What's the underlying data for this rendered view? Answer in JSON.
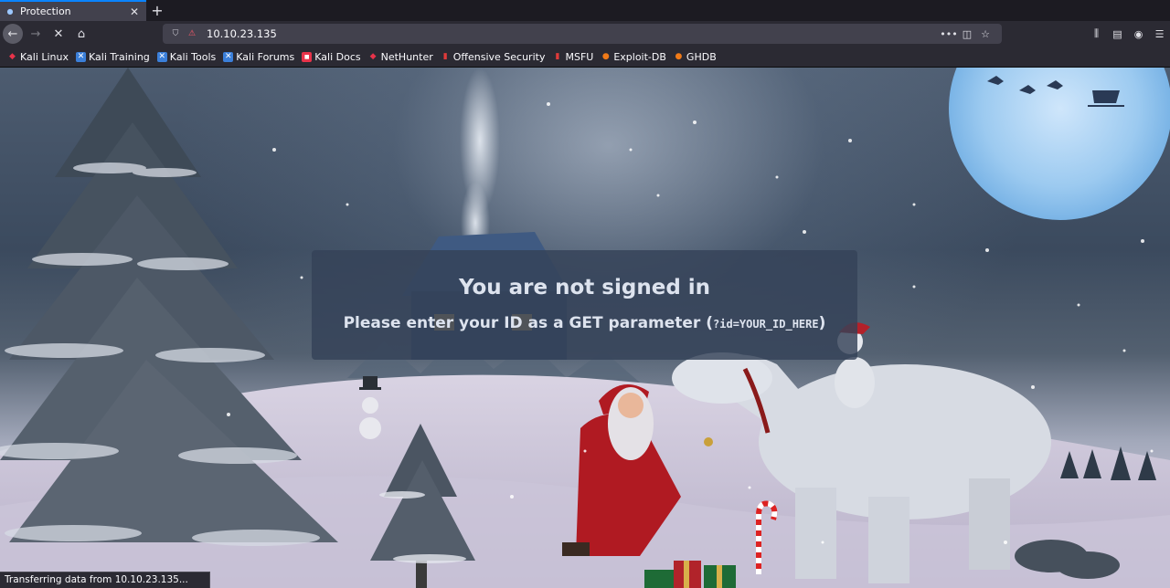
{
  "tab": {
    "title": "Protection",
    "favicon": "small-dot-icon",
    "close_glyph": "✕",
    "new_tab_glyph": "+"
  },
  "nav": {
    "back_glyph": "←",
    "forward_glyph": "→",
    "stop_glyph": "✕",
    "home_glyph": "⌂",
    "url": "10.10.23.135",
    "page_actions_glyph": "•••",
    "pocket_glyph": "◫",
    "star_glyph": "☆",
    "library_glyph": "⫼",
    "sidebar_glyph": "▤",
    "account_glyph": "◉",
    "menu_glyph": "☰"
  },
  "bookmarks": [
    {
      "label": "Kali Linux",
      "icon": "kali-dragon-icon",
      "color": "#e8334a",
      "glyph": "◆"
    },
    {
      "label": "Kali Training",
      "icon": "kali-training-icon",
      "color": "#3b7fd9",
      "glyph": "✕"
    },
    {
      "label": "Kali Tools",
      "icon": "kali-tools-icon",
      "color": "#3b7fd9",
      "glyph": "✕"
    },
    {
      "label": "Kali Forums",
      "icon": "kali-forums-icon",
      "color": "#3b7fd9",
      "glyph": "✕"
    },
    {
      "label": "Kali Docs",
      "icon": "kali-docs-icon",
      "color": "#e8334a",
      "glyph": "■"
    },
    {
      "label": "NetHunter",
      "icon": "nethunter-icon",
      "color": "#e8334a",
      "glyph": "◆"
    },
    {
      "label": "Offensive Security",
      "icon": "offsec-icon",
      "color": "#e03a3a",
      "glyph": "▮"
    },
    {
      "label": "MSFU",
      "icon": "msfu-icon",
      "color": "#e03a3a",
      "glyph": "▮"
    },
    {
      "label": "Exploit-DB",
      "icon": "exploit-db-icon",
      "color": "#f07a18",
      "glyph": "●"
    },
    {
      "label": "GHDB",
      "icon": "ghdb-icon",
      "color": "#f07a18",
      "glyph": "●"
    }
  ],
  "page": {
    "title": "You are not signed in",
    "subtitle_prefix": "Please enter your ID as a GET parameter (",
    "subtitle_code": "?id=YOUR_ID_HERE",
    "subtitle_suffix": ")"
  },
  "status": {
    "text": "Transferring data from 10.10.23.135..."
  },
  "colors": {
    "accent": "#0a84ff",
    "toolbar": "#2b2a33",
    "urlbar": "#42414d"
  }
}
